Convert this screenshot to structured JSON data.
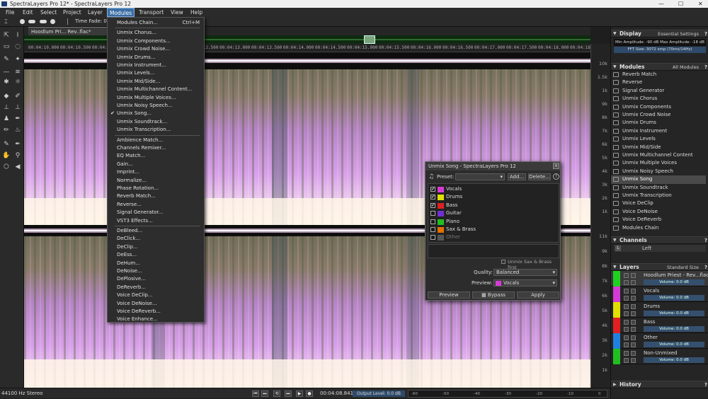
{
  "window": {
    "title": "SpectraLayers Pro 12* - SpectraLayers Pro 12"
  },
  "menubar": [
    "File",
    "Edit",
    "Select",
    "Project",
    "Layer",
    "Modules",
    "Transport",
    "View",
    "Help"
  ],
  "toolbar": {
    "time_fade_label": "Time Fade: 0.04"
  },
  "doc_tab": {
    "label": "Hoodlum Pri... Rev..flac*"
  },
  "ruler_ticks": [
    "00:04:10.000",
    "00:04:10.500",
    "00:04:11.000",
    "00:04:11.500",
    "00:04:12.000",
    "00:04:12.500",
    "00:04:13.000",
    "00:04:13.500",
    "00:04:14.000",
    "00:04:14.500",
    "00:04:15.000",
    "00:04:15.500",
    "00:04:16.000",
    "00:04:16.500",
    "00:04:17.000",
    "00:04:17.500",
    "00:04:18.000",
    "00:04:18.500"
  ],
  "freq_ticks_ch1": [
    "10k",
    "1.5k",
    "1k",
    "9k",
    "8k",
    "7k",
    "6k",
    "5k",
    "4k",
    "3k",
    "2k",
    "1k"
  ],
  "freq_ticks_ch2": [
    "11k",
    "9k",
    "8k",
    "7k",
    "6k",
    "5k",
    "4k",
    "3k",
    "2k",
    "1k"
  ],
  "modules_menu": {
    "chain": {
      "label": "Modules Chain...",
      "shortcut": "Ctrl+M"
    },
    "group1": [
      "Unmix Chorus...",
      "Unmix Components...",
      "Unmix Crowd Noise...",
      "Unmix Drums...",
      "Unmix Instrument...",
      "Unmix Levels...",
      "Unmix Mid/Side...",
      "Unmix Multichannel Content...",
      "Unmix Multiple Voices...",
      "Unmix Noisy Speech...",
      "Unmix Song...",
      "Unmix Soundtrack...",
      "Unmix Transcription..."
    ],
    "checked": "Unmix Song...",
    "group2": [
      "Ambience Match...",
      "Channels Remixer...",
      "EQ Match...",
      "Gain...",
      "Imprint...",
      "Normalize...",
      "Phase Rotation...",
      "Reverb Match...",
      "Reverse...",
      "Signal Generator...",
      "VST3 Effects..."
    ],
    "group3": [
      "DeBleed...",
      "DeClick...",
      "DeClip...",
      "DeEss...",
      "DeHum...",
      "DeNoise...",
      "DePlosive...",
      "DeReverb...",
      "Voice DeClip...",
      "Voice DeNoise...",
      "Voice DeReverb...",
      "Voice Enhance..."
    ]
  },
  "unmix_dialog": {
    "title": "Unmix Song - SpectraLayers Pro 12",
    "preset_label": "Preset:",
    "add_label": "Add...",
    "delete_label": "Delete...",
    "stems": [
      {
        "name": "Vocals",
        "checked": true,
        "color": "#d63ad6"
      },
      {
        "name": "Drums",
        "checked": true,
        "color": "#e0e000"
      },
      {
        "name": "Bass",
        "checked": true,
        "color": "#e02020"
      },
      {
        "name": "Guitar",
        "checked": false,
        "color": "#7030d0"
      },
      {
        "name": "Piano",
        "checked": false,
        "color": "#20c020"
      },
      {
        "name": "Sax & Brass",
        "checked": false,
        "color": "#e07000"
      },
      {
        "name": "Other",
        "checked": false,
        "color": "#555555"
      }
    ],
    "unmix_first_label": "Unmix Sax & Brass first",
    "quality_label": "Quality:",
    "quality_value": "Balanced",
    "preview_label": "Preview:",
    "preview_value": "Vocals",
    "preview_button": "Preview",
    "bypass_button": "Bypass",
    "apply_button": "Apply"
  },
  "display_panel": {
    "title": "Display",
    "preset": "Essential Settings",
    "min_amp": "Min Amplitude: -90 dB",
    "max_amp": "Max Amplitude: -18 dB",
    "fft": "FFT Size: 3072 smp (70ms/14Hz)"
  },
  "modules_panel": {
    "title": "Modules",
    "filter": "All Modules",
    "items": [
      "Reverb Match",
      "Reverse",
      "Signal Generator",
      "Unmix Chorus",
      "Unmix Components",
      "Unmix Crowd Noise",
      "Unmix Drums",
      "Unmix Instrument",
      "Unmix Levels",
      "Unmix Mid/Side",
      "Unmix Multichannel Content",
      "Unmix Multiple Voices",
      "Unmix Noisy Speech",
      "Unmix Song",
      "Unmix Soundtrack",
      "Unmix Transcription",
      "Voice DeClip",
      "Voice DeNoise",
      "Voice DeReverb",
      "Modules Chain"
    ],
    "selected": "Unmix Song"
  },
  "channels_panel": {
    "title": "Channels",
    "item": "Left",
    "tag": "L"
  },
  "layers_panel": {
    "title": "Layers",
    "size": "Standard Size",
    "layers": [
      {
        "name": "Hoodlum Priest - Rev...flac",
        "volume": "Volume: 0.0 dB",
        "color": "#20d020"
      },
      {
        "name": "Vocals",
        "volume": "Volume: 0.0 dB",
        "color": "#d63ad6"
      },
      {
        "name": "Drums",
        "volume": "Volume: 0.0 dB",
        "color": "#e0e000"
      },
      {
        "name": "Bass",
        "volume": "Volume: 0.0 dB",
        "color": "#e02020"
      },
      {
        "name": "Other",
        "volume": "Volume: 0.0 dB",
        "color": "#2080e0"
      },
      {
        "name": "Non-Unmixed",
        "volume": "Volume: 0.0 dB",
        "color": "#20c020"
      }
    ]
  },
  "history_panel": {
    "title": "History"
  },
  "status": {
    "format": "44100 Hz Stereo",
    "time": "00:04:08.841",
    "output_level": "Output Level: 0.0 dB",
    "meter_ticks": [
      "-60",
      "-50",
      "-40",
      "-30",
      "-20",
      "-10",
      "0"
    ]
  }
}
